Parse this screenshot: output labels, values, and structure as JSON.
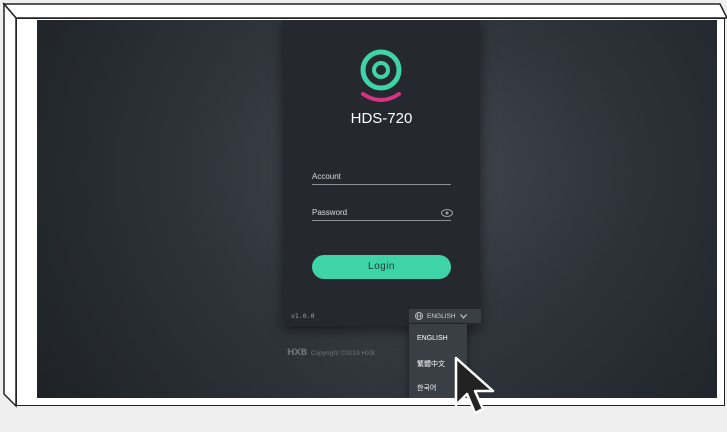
{
  "app": {
    "product_name": "HDS-720",
    "brand_mark": "HXB",
    "copyright": "Copyright ©2019 HXB",
    "version": "v1.0.0"
  },
  "login": {
    "account_label": "Account",
    "password_label": "Password",
    "login_button": "Login"
  },
  "language": {
    "current": "ENGLISH",
    "options": [
      "ENGLISH",
      "繁體中文",
      "한국어"
    ]
  },
  "colors": {
    "accent": "#3fd4a8",
    "logo_pink": "#d63384",
    "panel": "#25292f"
  }
}
